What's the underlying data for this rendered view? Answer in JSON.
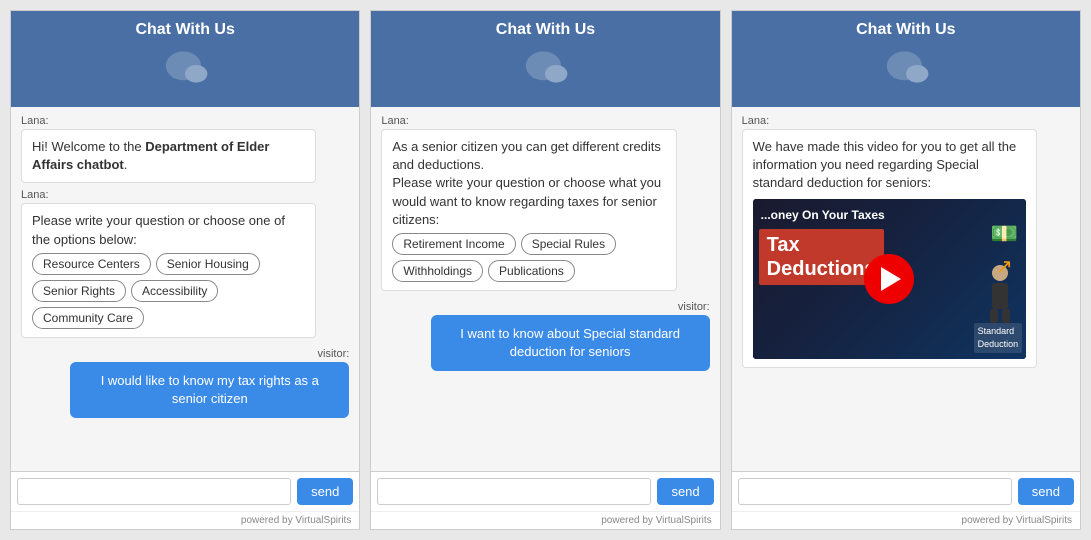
{
  "widgets": [
    {
      "id": "widget1",
      "header": "Chat With Us",
      "messages": [
        {
          "type": "bot",
          "sender": "Lana:",
          "text": "Hi! Welcome to the Department of Elder Affairs chatbot."
        },
        {
          "type": "bot",
          "sender": "Lana:",
          "text": "Please write your question or choose one of the options below:",
          "options": [
            "Resource Centers",
            "Senior Housing",
            "Senior Rights",
            "Accessibility",
            "Community Care"
          ]
        },
        {
          "type": "visitor",
          "sender": "visitor:",
          "text": "I would like to know my tax rights as a senior citizen"
        }
      ],
      "input_placeholder": "",
      "send_label": "send",
      "powered_by": "powered by VirtualSpirits"
    },
    {
      "id": "widget2",
      "header": "Chat With Us",
      "messages": [
        {
          "type": "bot",
          "sender": "Lana:",
          "text": "As a senior citizen you can get different credits and deductions.\nPlease write your question or choose what you would want to know regarding taxes for senior citizens:",
          "options": [
            "Retirement Income",
            "Special Rules",
            "Withholdings",
            "Publications"
          ]
        },
        {
          "type": "visitor",
          "sender": "visitor:",
          "text": "I want to know about Special standard deduction for seniors"
        }
      ],
      "input_placeholder": "",
      "send_label": "send",
      "powered_by": "powered by VirtualSpirits"
    },
    {
      "id": "widget3",
      "header": "Chat With Us",
      "messages": [
        {
          "type": "bot",
          "sender": "Lana:",
          "text": "We have made this video for you to get all the information you need regarding Special standard deduction for seniors:",
          "has_video": true,
          "video_title": "...oney On Your Taxes",
          "video_sub": "Tax Deductions",
          "video_label": "Standard Deduction"
        }
      ],
      "input_placeholder": "",
      "send_label": "send",
      "powered_by": "powered by VirtualSpirits"
    }
  ]
}
